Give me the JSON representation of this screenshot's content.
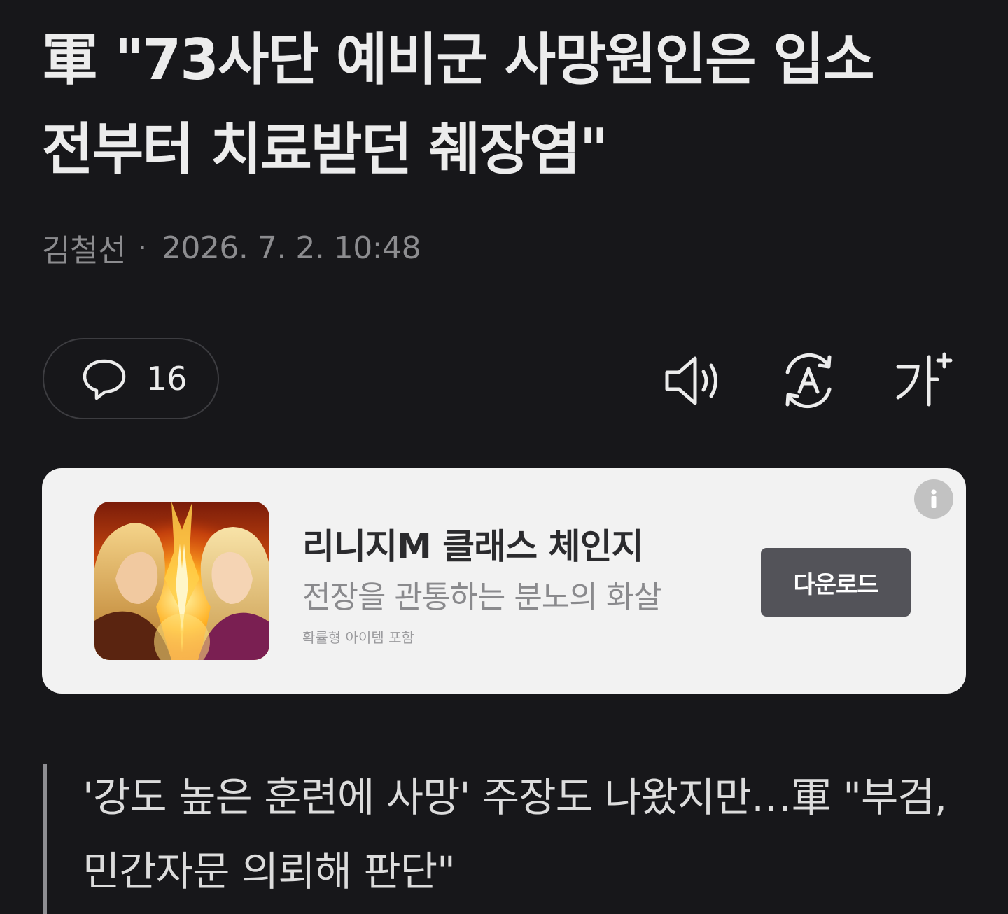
{
  "article": {
    "headline": "軍 \"73사단 예비군 사망원인은 입소 전부터 치료받던 췌장염\"",
    "author": "김철선",
    "separator": "·",
    "datetime": "2026. 7. 2. 10:48",
    "subheadline": "'강도 높은 훈련에 사망' 주장도 나왔지만…軍 \"부검, 민간자문 의뢰해 판단\""
  },
  "toolbar": {
    "comment_count": "16",
    "icons": [
      "comment-icon",
      "speaker-icon",
      "translate-icon",
      "font-size-icon"
    ],
    "font_size_label": "가"
  },
  "ad": {
    "title": "리니지M 클래스 체인지",
    "description": "전장을 관통하는 분노의 화살",
    "notice": "확률형 아이템 포함",
    "button_label": "다운로드",
    "info_icon": "info-icon"
  },
  "colors": {
    "background": "#17171a",
    "headline_text": "#ececec",
    "meta_text": "#8c8c8f",
    "ad_card": "#f2f2f2",
    "ad_button": "#535359"
  }
}
